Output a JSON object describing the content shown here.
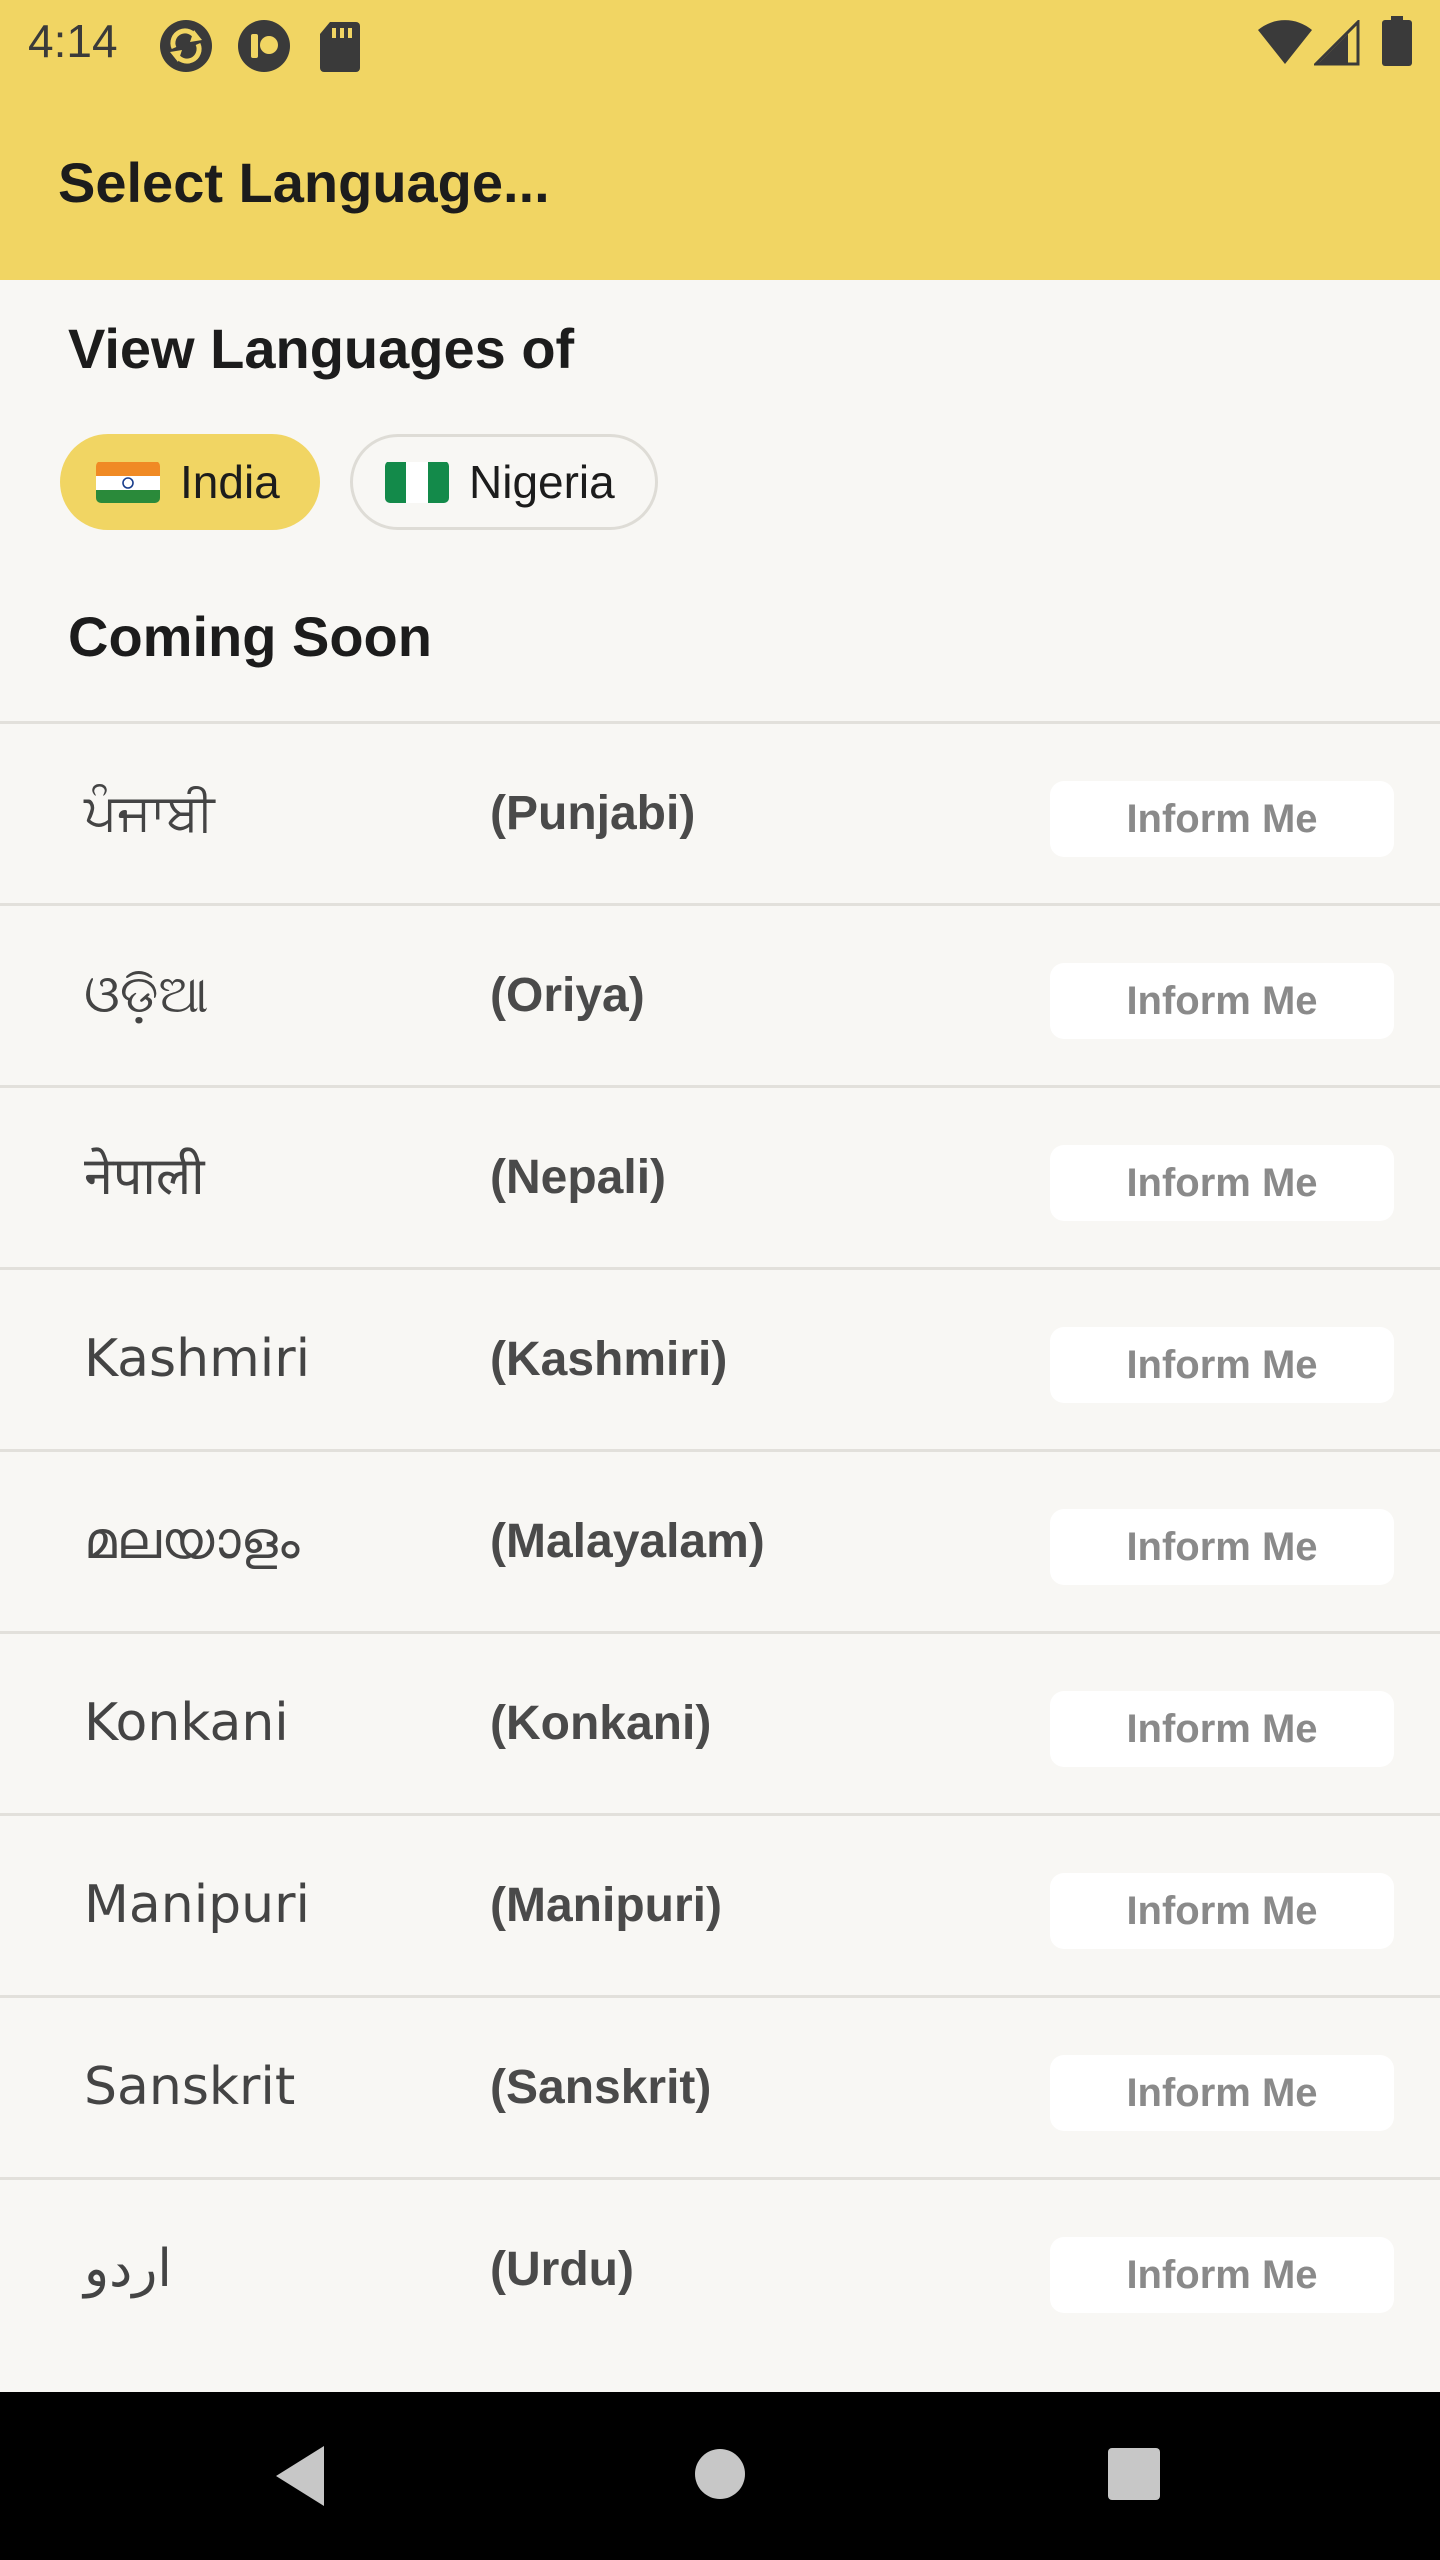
{
  "status_bar": {
    "time": "4:14",
    "notification_icons": [
      "sync-icon",
      "app-icon",
      "sd-card-icon"
    ],
    "system_icons": [
      "wifi-icon",
      "signal-icon",
      "battery-icon"
    ]
  },
  "app_bar": {
    "title": "Select Language..."
  },
  "region_section": {
    "title": "View Languages of",
    "chips": [
      {
        "label": "India",
        "flag": "india-flag-icon",
        "selected": true
      },
      {
        "label": "Nigeria",
        "flag": "nigeria-flag-icon",
        "selected": false
      }
    ]
  },
  "coming_soon": {
    "title": "Coming Soon",
    "button_label": "Inform Me",
    "languages": [
      {
        "native": "ਪੰਜਾਬੀ",
        "english": "(Punjabi)"
      },
      {
        "native": "ଓଡ଼ିଆ",
        "english": "(Oriya)"
      },
      {
        "native": "नेपाली",
        "english": "(Nepali)"
      },
      {
        "native": "Kashmiri",
        "english": "(Kashmiri)"
      },
      {
        "native": "മലയാളം",
        "english": "(Malayalam)"
      },
      {
        "native": "Konkani",
        "english": "(Konkani)"
      },
      {
        "native": "Manipuri",
        "english": "(Manipuri)"
      },
      {
        "native": "Sanskrit",
        "english": "(Sanskrit)"
      },
      {
        "native": "اردو",
        "english": "(Urdu)"
      }
    ]
  },
  "nav_bar": {
    "buttons": [
      "back-icon",
      "home-icon",
      "recents-icon"
    ]
  },
  "colors": {
    "accent_yellow": "#f1d563",
    "background": "#f8f7f4",
    "nav_bar": "#000000"
  }
}
